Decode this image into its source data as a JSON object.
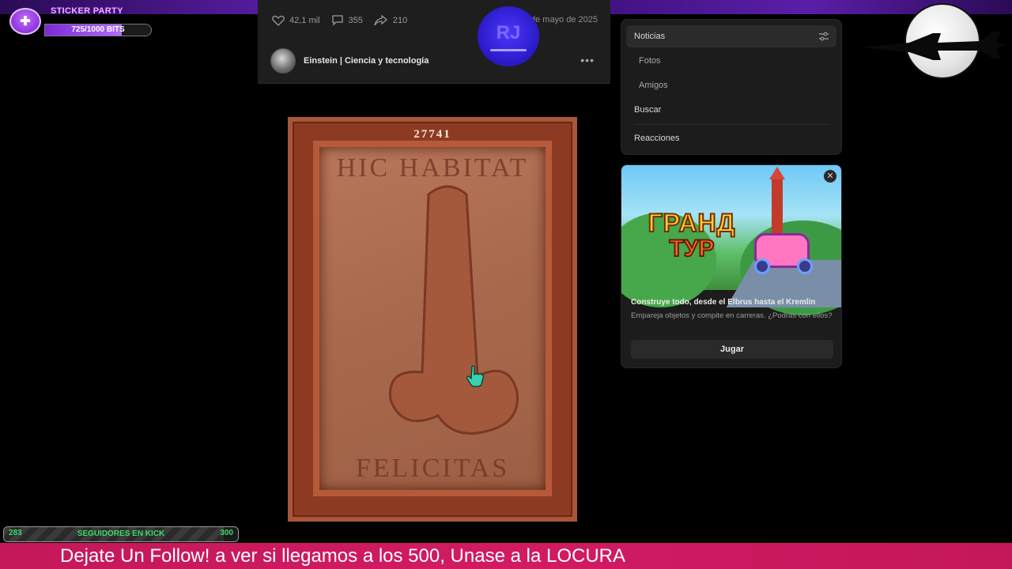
{
  "stream_overlay": {
    "sticker_party": {
      "title": "STICKER PARTY",
      "bits_text": "725/1000 BITS",
      "progress": 0.725,
      "heart_icon": "heart-plus-icon"
    },
    "followers": {
      "current": "283",
      "label": "SEGUIDORES EN KICK",
      "goal": "300",
      "progress": 0.943
    },
    "ticker_text": "Dejate Un Follow!  a ver si llegamos a los 500, Unase a la LOCURA",
    "logo_text": "RJ"
  },
  "post": {
    "likes": "42,1 mil",
    "comments": "355",
    "shares": "210",
    "date": "de mayo de 2025",
    "author": "Einstein | Ciencia y tecnología",
    "more_icon": "more-dots-icon",
    "image": {
      "number": "27741",
      "inscription_top": "HIC HABITAT",
      "inscription_bottom": "FELICITAS"
    }
  },
  "sidebar": {
    "menu": [
      {
        "label": "Noticias",
        "active": true
      },
      {
        "label": "Fotos",
        "sub": true
      },
      {
        "label": "Amigos",
        "sub": true
      },
      {
        "label": "Buscar"
      },
      {
        "label": "Reacciones"
      }
    ],
    "ad": {
      "art_line1": "ГРАНД",
      "art_line2": "ТУР",
      "headline": "Construye todo, desde el Elbrus hasta el Kremlin",
      "description": "Empareja objetos y compite en carreras. ¿Podrás con ellos?",
      "button": "Jugar",
      "close_icon": "close-icon"
    }
  },
  "colors": {
    "accent_purple": "#7b2ad8",
    "kick_green": "#3ddc68",
    "ticker_pink": "#d21a63"
  }
}
